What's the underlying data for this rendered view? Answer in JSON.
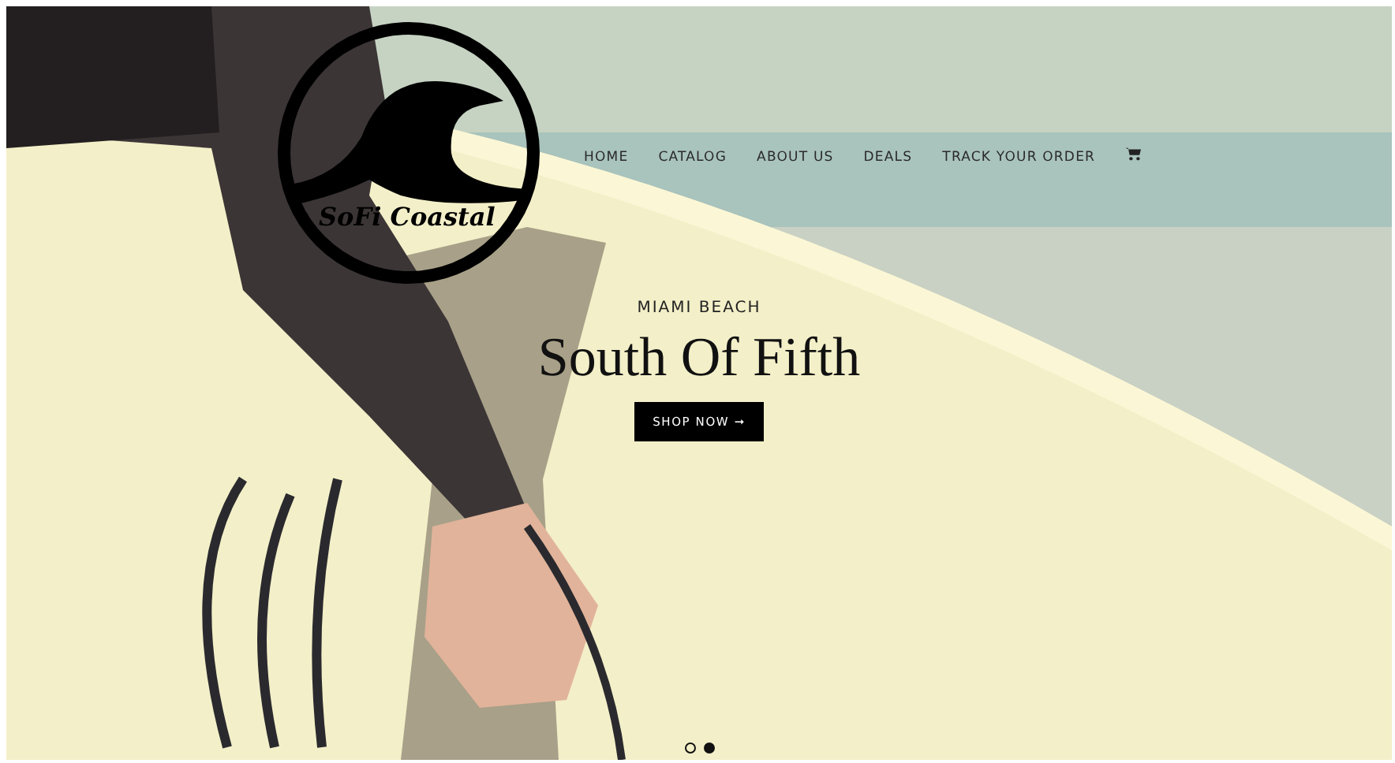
{
  "logo": {
    "text": "SoFi Coastal"
  },
  "nav": [
    {
      "label": "HOME",
      "kind": "link"
    },
    {
      "label": "CATALOG",
      "kind": "link"
    },
    {
      "label": "ABOUT US",
      "kind": "link"
    },
    {
      "label": "DEALS",
      "kind": "link"
    },
    {
      "label": "TRACK YOUR ORDER",
      "kind": "link"
    },
    {
      "kind": "cart"
    }
  ],
  "hero": {
    "kind": "picture",
    "eyebrow": "MIAMI BEACH",
    "title": "South Of Fifth",
    "button": "SHOP NOW ➞"
  },
  "slides": [
    {
      "selected": false
    },
    {
      "selected": true
    }
  ]
}
